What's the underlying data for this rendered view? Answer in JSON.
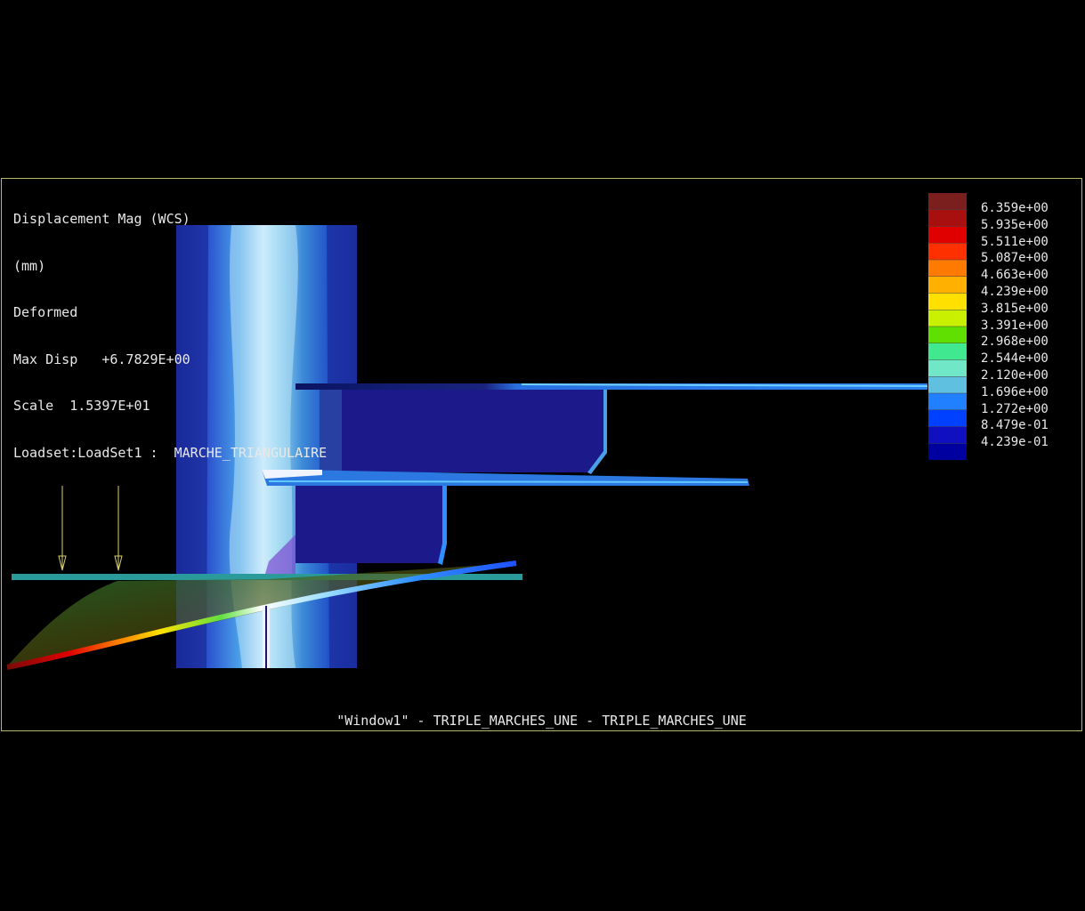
{
  "info": {
    "quantity": "Displacement Mag (WCS)",
    "unit": "(mm)",
    "mode": "Deformed",
    "max_disp": "Max Disp   +6.7829E+00",
    "scale": "Scale  1.5397E+01",
    "loadset": "Loadset:LoadSet1 :  MARCHE_TRIANGULAIRE"
  },
  "legend": {
    "values": [
      "6.359e+00",
      "5.935e+00",
      "5.511e+00",
      "5.087e+00",
      "4.663e+00",
      "4.239e+00",
      "3.815e+00",
      "3.391e+00",
      "2.968e+00",
      "2.544e+00",
      "2.120e+00",
      "1.696e+00",
      "1.272e+00",
      "8.479e-01",
      "4.239e-01"
    ],
    "colors": [
      "#7a1e1e",
      "#a81010",
      "#e00000",
      "#ff3000",
      "#ff7a00",
      "#ffb000",
      "#ffe000",
      "#c8f000",
      "#60e000",
      "#40e890",
      "#70e8c8",
      "#60c0e0",
      "#2080ff",
      "#0040ff",
      "#1010c0",
      "#0000a0"
    ]
  },
  "window_title": "\"Window1\" - TRIPLE_MARCHES_UNE - TRIPLE_MARCHES_UNE"
}
